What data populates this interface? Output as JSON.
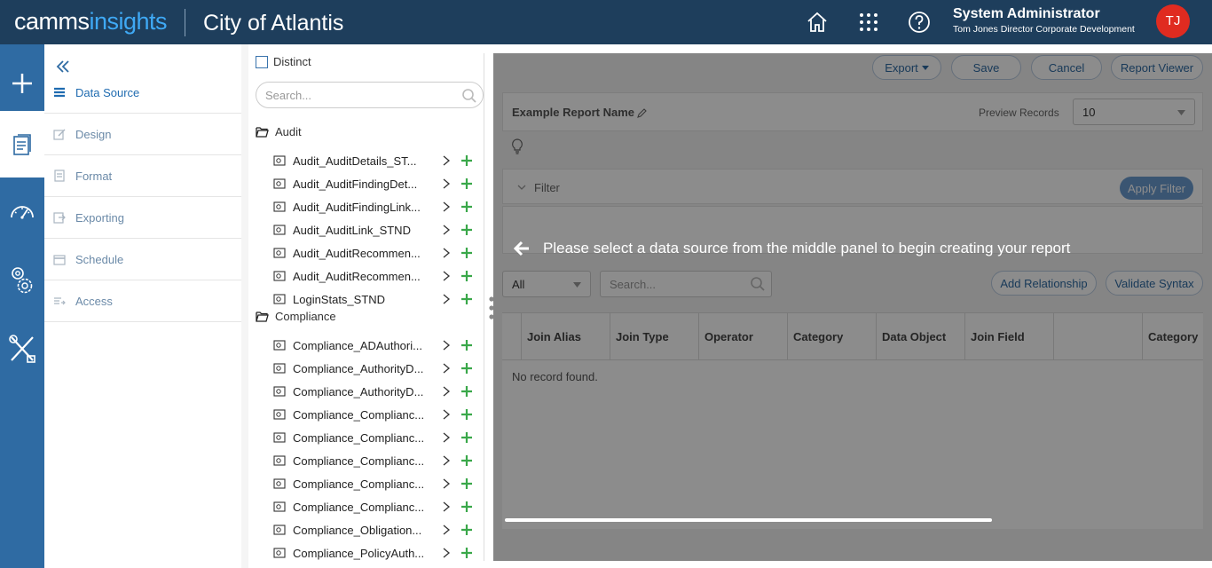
{
  "header": {
    "brand_part1": "camms",
    "brand_part2": "insights",
    "org_name": "City of Atlantis",
    "icons": [
      "home-icon",
      "apps-grid-icon",
      "help-icon"
    ],
    "user_name": "System Administrator",
    "user_title": "Tom Jones Director Corporate Development",
    "avatar_initials": "TJ"
  },
  "rail": {
    "items": [
      "add-icon",
      "report-document-icon",
      "dashboard-gauge-icon",
      "settings-gears-icon",
      "tools-icon"
    ]
  },
  "menu": {
    "items": [
      {
        "label": "Data Source",
        "icon": "list-icon",
        "active": true
      },
      {
        "label": "Design",
        "icon": "edit-icon",
        "active": false
      },
      {
        "label": "Format",
        "icon": "format-icon",
        "active": false
      },
      {
        "label": "Exporting",
        "icon": "export-icon",
        "active": false
      },
      {
        "label": "Schedule",
        "icon": "calendar-icon",
        "active": false
      },
      {
        "label": "Access",
        "icon": "access-icon",
        "active": false
      }
    ]
  },
  "tree": {
    "distinct_label": "Distinct",
    "search_placeholder": "Search...",
    "groups": [
      {
        "name": "Audit",
        "items": [
          "Audit_AuditDetails_ST...",
          "Audit_AuditFindingDet...",
          "Audit_AuditFindingLink...",
          "Audit_AuditLink_STND",
          "Audit_AuditRecommen...",
          "Audit_AuditRecommen...",
          "LoginStats_STND"
        ]
      },
      {
        "name": "Compliance",
        "items": [
          "Compliance_ADAuthori...",
          "Compliance_AuthorityD...",
          "Compliance_AuthorityD...",
          "Compliance_Complianc...",
          "Compliance_Complianc...",
          "Compliance_Complianc...",
          "Compliance_Complianc...",
          "Compliance_Complianc...",
          "Compliance_Obligation...",
          "Compliance_PolicyAuth..."
        ]
      }
    ]
  },
  "right": {
    "buttons": {
      "export": "Export",
      "save": "Save",
      "cancel": "Cancel",
      "report_viewer": "Report Viewer"
    },
    "report_name": "Example Report Name",
    "preview_label": "Preview Records",
    "preview_value": "10",
    "filter_label": "Filter",
    "apply_filter": "Apply Filter",
    "all_select": "All",
    "search_placeholder": "Search...",
    "add_relationship": "Add Relationship",
    "validate_syntax": "Validate Syntax",
    "columns": [
      "Join Alias",
      "Join Type",
      "Operator",
      "Category",
      "Data Object",
      "Join Field",
      "",
      "Category"
    ],
    "empty_text": "No record found.",
    "overlay_message": "Please select a data source from the middle panel to begin creating your report"
  }
}
